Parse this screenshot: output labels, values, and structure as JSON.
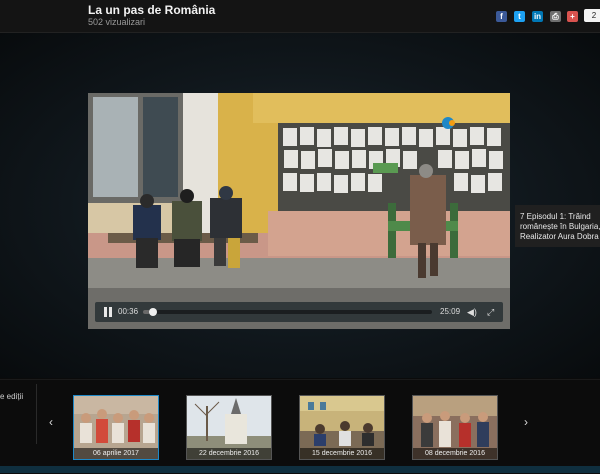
{
  "header": {
    "title": "La un pas de România",
    "views": "502 vizualizari",
    "share_count": "2",
    "share_icons": [
      "facebook-icon",
      "twitter-icon",
      "linkedin-icon",
      "print-icon",
      "plus-icon"
    ]
  },
  "player": {
    "current_time": "00:36",
    "duration": "25:09",
    "progress": 0.024
  },
  "next_episode": {
    "line1": "7 Episodul 1: Trăind",
    "line2": "românește în Bulgaria,",
    "line3": "Realizator Aura Dobra"
  },
  "strip": {
    "label": "e ediții",
    "thumbnails": [
      {
        "date": "06 aprilie 2017"
      },
      {
        "date": "22 decembrie 2016"
      },
      {
        "date": "15 decembrie 2016"
      },
      {
        "date": "08 decembrie 2016"
      }
    ]
  },
  "colors": {
    "facebook": "#3b5998",
    "twitter": "#1da1f2",
    "linkedin": "#0077b5",
    "print": "#6f6f6f",
    "plus": "#d9534f",
    "active_thumb_border": "#1e88c7"
  }
}
